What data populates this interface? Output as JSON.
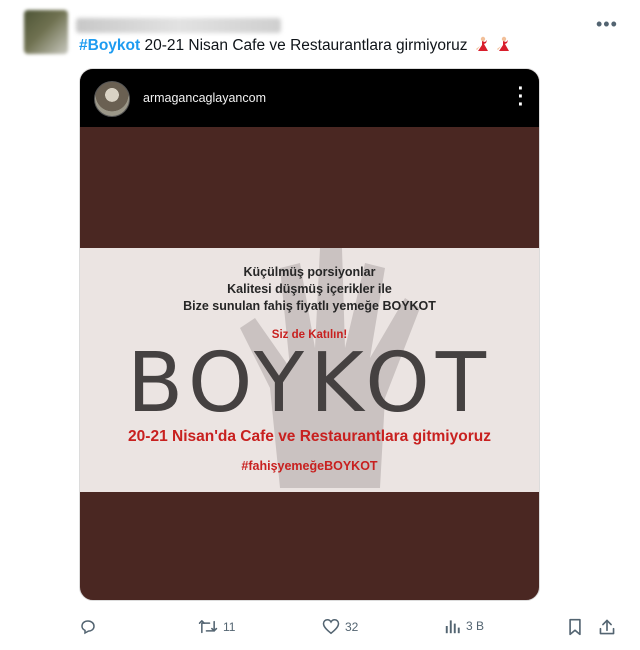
{
  "tweet": {
    "hashtag": "#Boykot",
    "text": " 20-21 Nisan Cafe ve Restaurantlara girmiyoruz"
  },
  "embed": {
    "username": "armagancaglayancom",
    "lines": [
      "Küçülmüş porsiyonlar",
      "Kalitesi düşmüş içerikler ile",
      "Bize sunulan fahiş fiyatlı yemeğe BOYKOT"
    ],
    "call": "Siz de Katılın!",
    "headline": "BOYKOT",
    "date_line": "20-21 Nisan'da Cafe ve Restaurantlara gitmiyoruz",
    "hashtag_line": "#fahişyemeğeBOYKOT"
  },
  "actions": {
    "retweets": "11",
    "likes": "32",
    "views": "3 B"
  },
  "colors": {
    "accent": "#1d9bf0",
    "banner_red": "#c8201f",
    "card_bg": "#4a2722"
  }
}
